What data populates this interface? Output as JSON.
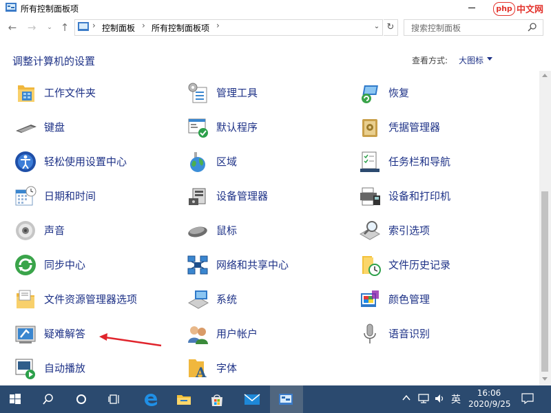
{
  "window": {
    "title": "所有控制面板项"
  },
  "address": {
    "crumbs": [
      "控制面板",
      "所有控制面板项"
    ],
    "search_placeholder": "搜索控制面板"
  },
  "content": {
    "heading": "调整计算机的设置",
    "view_by_label": "查看方式:",
    "view_by_value": "大图标"
  },
  "items": [
    {
      "label": "工作文件夹",
      "icon": "work-folders-icon"
    },
    {
      "label": "管理工具",
      "icon": "admin-tools-icon"
    },
    {
      "label": "恢复",
      "icon": "recovery-icon"
    },
    {
      "label": "键盘",
      "icon": "keyboard-icon"
    },
    {
      "label": "默认程序",
      "icon": "default-programs-icon"
    },
    {
      "label": "凭据管理器",
      "icon": "credential-manager-icon"
    },
    {
      "label": "轻松使用设置中心",
      "icon": "ease-of-access-icon"
    },
    {
      "label": "区域",
      "icon": "region-icon"
    },
    {
      "label": "任务栏和导航",
      "icon": "taskbar-navigation-icon"
    },
    {
      "label": "日期和时间",
      "icon": "date-time-icon"
    },
    {
      "label": "设备管理器",
      "icon": "device-manager-icon"
    },
    {
      "label": "设备和打印机",
      "icon": "devices-printers-icon"
    },
    {
      "label": "声音",
      "icon": "sound-icon"
    },
    {
      "label": "鼠标",
      "icon": "mouse-icon"
    },
    {
      "label": "索引选项",
      "icon": "indexing-options-icon"
    },
    {
      "label": "同步中心",
      "icon": "sync-center-icon"
    },
    {
      "label": "网络和共享中心",
      "icon": "network-sharing-icon"
    },
    {
      "label": "文件历史记录",
      "icon": "file-history-icon"
    },
    {
      "label": "文件资源管理器选项",
      "icon": "explorer-options-icon"
    },
    {
      "label": "系统",
      "icon": "system-icon"
    },
    {
      "label": "颜色管理",
      "icon": "color-management-icon"
    },
    {
      "label": "疑难解答",
      "icon": "troubleshooting-icon"
    },
    {
      "label": "用户帐户",
      "icon": "user-accounts-icon"
    },
    {
      "label": "语音识别",
      "icon": "speech-recognition-icon"
    },
    {
      "label": "自动播放",
      "icon": "autoplay-icon"
    },
    {
      "label": "字体",
      "icon": "fonts-icon"
    }
  ],
  "taskbar": {
    "ime": "英",
    "time": "16:06",
    "date": "2020/9/25"
  },
  "watermark": {
    "badge": "php",
    "text": "中文网"
  },
  "colors": {
    "link": "#1e3287",
    "taskbar": "#2b4a6f",
    "arrow": "#e0242c"
  }
}
